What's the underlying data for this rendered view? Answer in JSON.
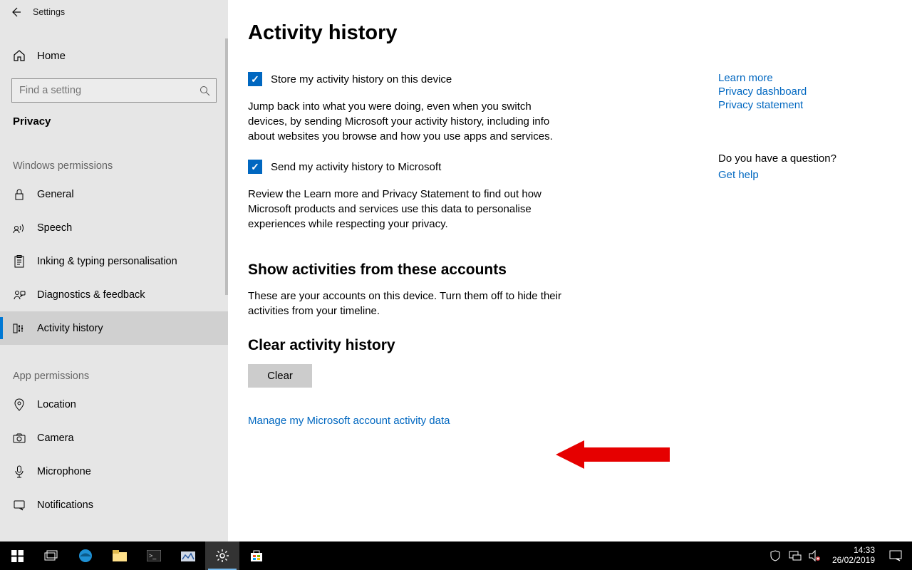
{
  "window": {
    "title": "Settings"
  },
  "sidebar": {
    "home": "Home",
    "search_placeholder": "Find a setting",
    "section": "Privacy",
    "group_windows": "Windows permissions",
    "group_app": "App permissions",
    "items_windows": [
      {
        "label": "General"
      },
      {
        "label": "Speech"
      },
      {
        "label": "Inking & typing personalisation"
      },
      {
        "label": "Diagnostics & feedback"
      },
      {
        "label": "Activity history"
      }
    ],
    "items_app": [
      {
        "label": "Location"
      },
      {
        "label": "Camera"
      },
      {
        "label": "Microphone"
      },
      {
        "label": "Notifications"
      }
    ]
  },
  "page": {
    "heading": "Activity history",
    "chk1": "Store my activity history on this device",
    "desc1": "Jump back into what you were doing, even when you switch devices, by sending Microsoft your activity history, including info about websites you browse and how you use apps and services.",
    "chk2": "Send my activity history to Microsoft",
    "desc2": "Review the Learn more and Privacy Statement to find out how Microsoft products and services use this data to personalise experiences while respecting your privacy.",
    "accounts_h": "Show activities from these accounts",
    "accounts_desc": "These are your accounts on this device. Turn them off to hide their activities from your timeline.",
    "clear_h": "Clear activity history",
    "clear_btn": "Clear",
    "manage_link": "Manage my Microsoft account activity data"
  },
  "side_links": {
    "learn_more": "Learn more",
    "dashboard": "Privacy dashboard",
    "statement": "Privacy statement",
    "question": "Do you have a question?",
    "get_help": "Get help"
  },
  "taskbar": {
    "time": "14:33",
    "date": "26/02/2019"
  }
}
